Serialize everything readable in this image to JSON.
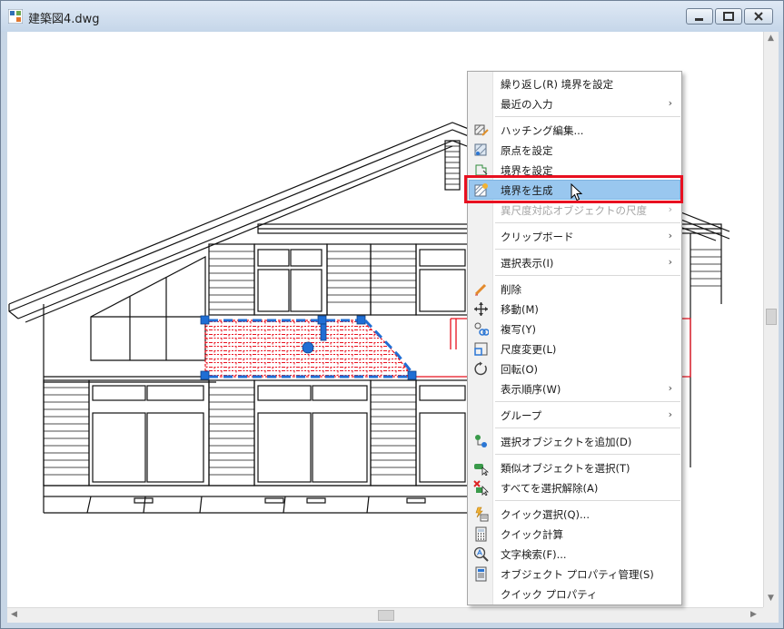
{
  "window": {
    "title": "建築図4.dwg",
    "controls": {
      "minimize": "minimize",
      "maximize": "maximize",
      "close": "close"
    }
  },
  "context_menu": {
    "items": [
      {
        "label": "繰り返し(R) 境界を設定",
        "icon": "",
        "submenu": false,
        "disabled": false
      },
      {
        "label": "最近の入力",
        "icon": "",
        "submenu": true,
        "disabled": false
      },
      {
        "label": "ハッチング編集...",
        "icon": "hatch-edit-icon",
        "submenu": false,
        "disabled": false
      },
      {
        "label": "原点を設定",
        "icon": "set-origin-icon",
        "submenu": false,
        "disabled": false
      },
      {
        "label": "境界を設定",
        "icon": "set-boundary-icon",
        "submenu": false,
        "disabled": false
      },
      {
        "label": "境界を生成",
        "icon": "generate-boundary-icon",
        "submenu": false,
        "disabled": false,
        "highlighted": true
      },
      {
        "label": "異尺度対応オブジェクトの尺度",
        "icon": "",
        "submenu": true,
        "disabled": true
      },
      {
        "label": "クリップボード",
        "icon": "",
        "submenu": true,
        "disabled": false
      },
      {
        "label": "選択表示(I)",
        "icon": "",
        "submenu": true,
        "disabled": false
      },
      {
        "label": "削除",
        "icon": "erase-icon",
        "submenu": false,
        "disabled": false
      },
      {
        "label": "移動(M)",
        "icon": "move-icon",
        "submenu": false,
        "disabled": false
      },
      {
        "label": "複写(Y)",
        "icon": "copy-icon",
        "submenu": false,
        "disabled": false
      },
      {
        "label": "尺度変更(L)",
        "icon": "scale-icon",
        "submenu": false,
        "disabled": false
      },
      {
        "label": "回転(O)",
        "icon": "rotate-icon",
        "submenu": false,
        "disabled": false
      },
      {
        "label": "表示順序(W)",
        "icon": "",
        "submenu": true,
        "disabled": false
      },
      {
        "label": "グループ",
        "icon": "",
        "submenu": true,
        "disabled": false
      },
      {
        "label": "選択オブジェクトを追加(D)",
        "icon": "add-selected-icon",
        "submenu": false,
        "disabled": false
      },
      {
        "label": "類似オブジェクトを選択(T)",
        "icon": "select-similar-icon",
        "submenu": false,
        "disabled": false
      },
      {
        "label": "すべてを選択解除(A)",
        "icon": "deselect-all-icon",
        "submenu": false,
        "disabled": false
      },
      {
        "label": "クイック選択(Q)...",
        "icon": "quick-select-icon",
        "submenu": false,
        "disabled": false
      },
      {
        "label": "クイック計算",
        "icon": "quick-calc-icon",
        "submenu": false,
        "disabled": false
      },
      {
        "label": "文字検索(F)...",
        "icon": "find-text-icon",
        "submenu": false,
        "disabled": false
      },
      {
        "label": "オブジェクト プロパティ管理(S)",
        "icon": "properties-icon",
        "submenu": false,
        "disabled": false
      },
      {
        "label": "クイック プロパティ",
        "icon": "",
        "submenu": false,
        "disabled": false
      }
    ],
    "submenu_arrow": "›"
  },
  "colors": {
    "highlight": "#99c7ef",
    "callout_box": "#e81020",
    "hatch": "#e8101e",
    "grip": "#1f6ed4"
  }
}
